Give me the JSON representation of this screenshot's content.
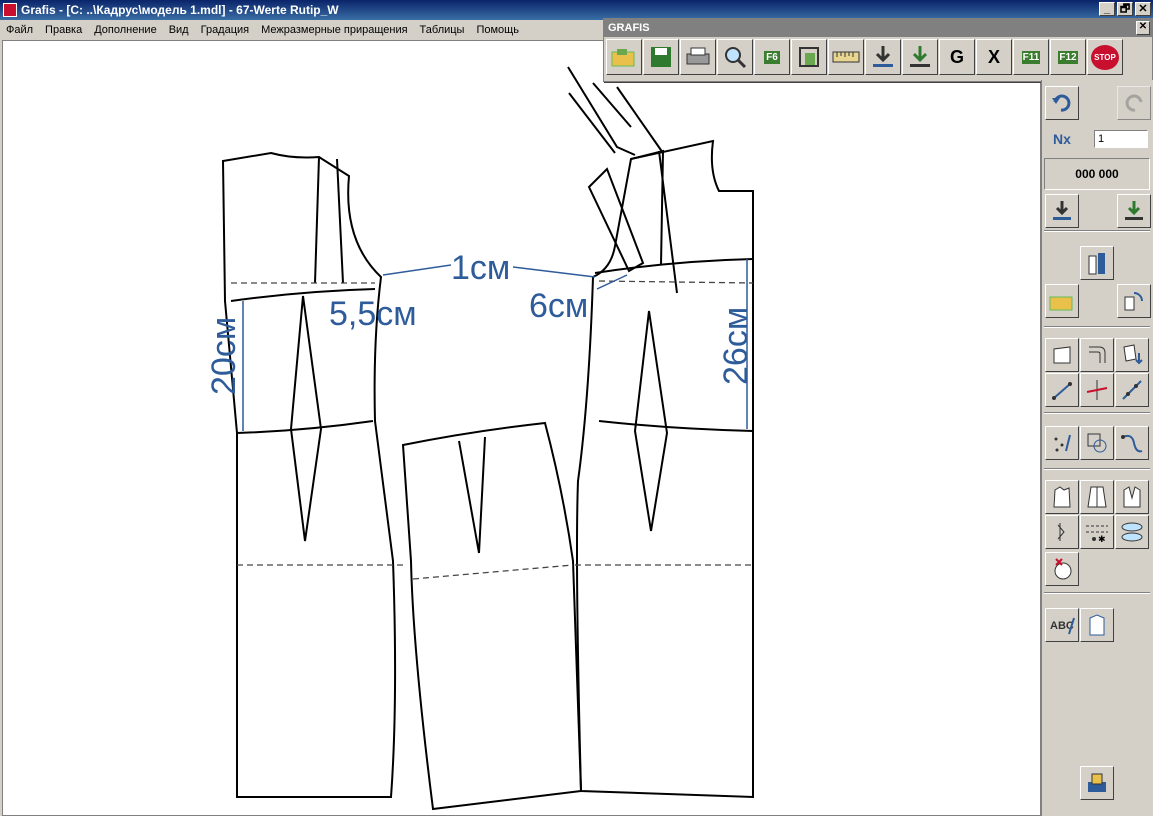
{
  "window": {
    "title": "Grafis - [C: ..\\Кадрус\\модель 1.mdl] - 67-Werte Rutip_W",
    "buttons": [
      "_",
      "🗗",
      "✕"
    ]
  },
  "menu": [
    "Файл",
    "Правка",
    "Дополнение",
    "Вид",
    "Градация",
    "Межразмерные приращения",
    "Таблицы",
    "Помощь"
  ],
  "toolbar": {
    "title": "GRAFIS",
    "close": "✕",
    "buttons": [
      {
        "name": "open-icon",
        "label": ""
      },
      {
        "name": "save-icon",
        "label": ""
      },
      {
        "name": "print-icon",
        "label": ""
      },
      {
        "name": "zoom-icon",
        "label": ""
      },
      {
        "name": "f6-icon",
        "label": "F6"
      },
      {
        "name": "frame-icon",
        "label": ""
      },
      {
        "name": "ruler-icon",
        "label": ""
      },
      {
        "name": "import-icon",
        "label": ""
      },
      {
        "name": "export-icon",
        "label": ""
      },
      {
        "name": "g-table-icon",
        "label": "G"
      },
      {
        "name": "x-table-icon",
        "label": "X"
      },
      {
        "name": "f11-icon",
        "label": "F11"
      },
      {
        "name": "f12-icon",
        "label": "F12"
      },
      {
        "name": "stop-icon",
        "label": "STOP"
      }
    ]
  },
  "panel": {
    "nx_value": "1",
    "nx_label": "Nx",
    "counter": "000 000"
  },
  "annotations": {
    "top_gap": "1см",
    "left_shift": "5,5см",
    "right_shift": "6см",
    "left_height": "20см",
    "right_height": "26см"
  },
  "colors": {
    "annotation": "#2e5c9a",
    "pattern_line": "#000000"
  }
}
